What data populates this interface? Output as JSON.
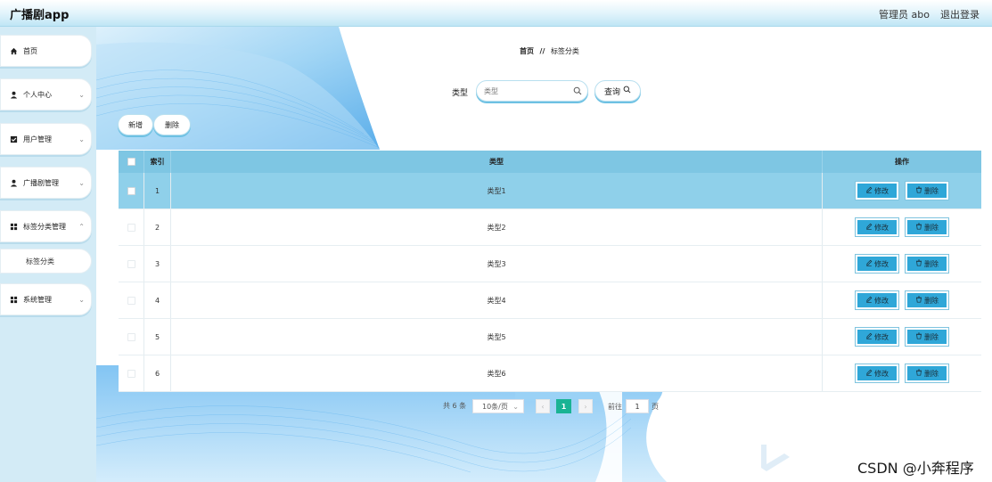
{
  "header": {
    "app_title": "广播剧app",
    "user_label": "管理员 abo",
    "logout": "退出登录"
  },
  "sidebar": {
    "items": [
      {
        "label": "首页",
        "icon": "home-icon"
      },
      {
        "label": "个人中心",
        "icon": "user-icon"
      },
      {
        "label": "用户管理",
        "icon": "checkbox-icon"
      },
      {
        "label": "广播剧管理",
        "icon": "user-icon"
      },
      {
        "label": "标签分类管理",
        "icon": "grid-icon"
      },
      {
        "label": "系统管理",
        "icon": "grid-icon"
      }
    ],
    "sub_item": "标签分类"
  },
  "breadcrumb": {
    "home": "首页",
    "separator": "//",
    "current": "标签分类"
  },
  "search": {
    "label": "类型",
    "placeholder": "类型",
    "value": "",
    "query_button": "查询"
  },
  "actions": {
    "add": "新增",
    "delete": "删除"
  },
  "table": {
    "headers": {
      "index": "索引",
      "type": "类型",
      "ops": "操作"
    },
    "rows": [
      {
        "index": "1",
        "type": "类型1",
        "selected": true
      },
      {
        "index": "2",
        "type": "类型2"
      },
      {
        "index": "3",
        "type": "类型3"
      },
      {
        "index": "4",
        "type": "类型4"
      },
      {
        "index": "5",
        "type": "类型5"
      },
      {
        "index": "6",
        "type": "类型6"
      }
    ],
    "edit_label": "修改",
    "delete_label": "删除"
  },
  "pagination": {
    "total": "共 6 条",
    "page_size": "10条/页",
    "current_page": "1",
    "goto_prefix": "前往",
    "goto_value": "1",
    "goto_suffix": "页",
    "prev": "‹",
    "next": "›"
  },
  "watermark": "CSDN @小奔程序",
  "colors": {
    "accent": "#2fa7d8",
    "header_row": "#7ec6e3",
    "selected_row": "#8fd0ea",
    "page_active": "#19b394"
  }
}
